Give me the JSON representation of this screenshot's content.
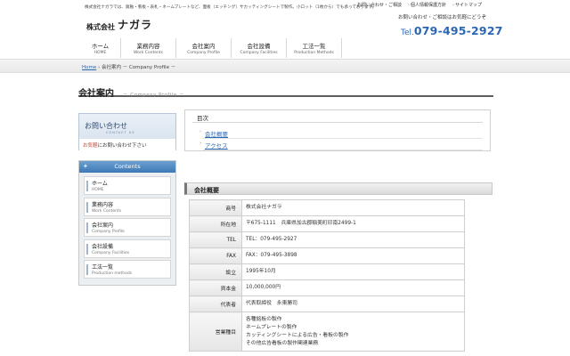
{
  "header": {
    "tagline": "株式会社ナガラでは、腐蝕・看板・表札・ネームプレートなど、面板（エッチング）サカッティングシートで製作。小ロット（1枚から）でも承っております。",
    "logo_small": "株式会社",
    "logo_big": "ナガラ",
    "top_links": [
      "お問い合わせ・ご相談",
      "個人情報保護方針",
      "サイトマップ"
    ],
    "contact_note": "お問い合わせ・ご相談はお気軽にどうぞ",
    "phone_label": "Tel.",
    "phone_number": "079-495-2927"
  },
  "gnav": [
    {
      "ja": "ホーム",
      "en": "HOME"
    },
    {
      "ja": "業務内容",
      "en": "Work Contents"
    },
    {
      "ja": "会社案内",
      "en": "Company Profile"
    },
    {
      "ja": "会社設備",
      "en": "Company Facilities"
    },
    {
      "ja": "工法一覧",
      "en": "Production Methods"
    }
  ],
  "breadcrumb": {
    "home": "Home",
    "current": " › 会社案内 － Company Profile －"
  },
  "page_title": {
    "ja": "会社案内",
    "en": "－ Company Profile －"
  },
  "sidebar": {
    "contact_title": "お問い合わせ",
    "contact_sub": "CONTACT US",
    "contact_text_red": "お気軽",
    "contact_text_rest": "にお問い合わせ下さい",
    "menu_title": "Contents",
    "items": [
      {
        "ja": "ホーム",
        "en": "HOME"
      },
      {
        "ja": "業務内容",
        "en": "Work Contents"
      },
      {
        "ja": "会社案内",
        "en": "Company Profile"
      },
      {
        "ja": "会社設備",
        "en": "Company Facilities"
      },
      {
        "ja": "工法一覧",
        "en": "Production methods"
      }
    ]
  },
  "toc": {
    "title": "目次",
    "items": [
      "会社概要",
      "アクセス"
    ]
  },
  "section": {
    "title": "会社概要"
  },
  "company_table": [
    {
      "label": "商号",
      "value": [
        "株式会社ナガラ"
      ]
    },
    {
      "label": "所在地",
      "value": [
        "〒675-1111　兵庫県加古郡稲美町印南2499-1"
      ]
    },
    {
      "label": "TEL",
      "value": [
        "TEL：079-495-2927"
      ]
    },
    {
      "label": "FAX",
      "value": [
        "FAX：079-495-3898"
      ]
    },
    {
      "label": "設立",
      "value": [
        "1995年10月"
      ]
    },
    {
      "label": "資本金",
      "value": [
        "10,000,000円"
      ]
    },
    {
      "label": "代表者",
      "value": [
        "代表取締役　永東勝司"
      ]
    },
    {
      "label": "営業種目",
      "value": [
        "各種銘板の製作",
        "ネームプレートの製作",
        "カッティングシートによる広告・看板の製作",
        "その他広告看板の製作関連業務"
      ]
    }
  ],
  "colors": {
    "accent_blue": "#2b67b3",
    "menu_header": "#3e78b6"
  }
}
